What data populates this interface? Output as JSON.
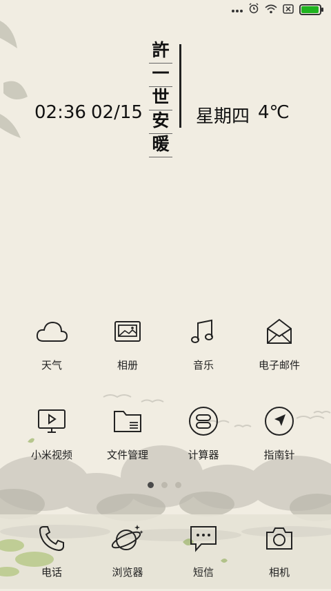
{
  "status_bar": {
    "battery_level": 0.95,
    "battery_color": "#1fb31f",
    "icons": [
      "more-dots-icon",
      "alarm-icon",
      "wifi-icon",
      "no-sim-icon",
      "battery-icon"
    ]
  },
  "clock": {
    "time": "02:36",
    "date": "02/15",
    "weekday": "星期四",
    "temperature": "4℃"
  },
  "calligraphy": {
    "characters": [
      "許",
      "一",
      "世",
      "安",
      "暖"
    ]
  },
  "apps": [
    {
      "label": "天气",
      "icon": "cloud-icon"
    },
    {
      "label": "相册",
      "icon": "photo-album-icon"
    },
    {
      "label": "音乐",
      "icon": "music-note-icon"
    },
    {
      "label": "电子邮件",
      "icon": "envelope-icon"
    },
    {
      "label": "小米视频",
      "icon": "video-player-icon"
    },
    {
      "label": "文件管理",
      "icon": "folder-icon"
    },
    {
      "label": "计算器",
      "icon": "calculator-icon"
    },
    {
      "label": "指南针",
      "icon": "compass-icon"
    }
  ],
  "page_indicator": {
    "count": 3,
    "active": 1
  },
  "dock": [
    {
      "label": "电话",
      "icon": "phone-icon"
    },
    {
      "label": "浏览器",
      "icon": "browser-planet-icon"
    },
    {
      "label": "短信",
      "icon": "message-bubble-icon"
    },
    {
      "label": "相机",
      "icon": "camera-icon"
    }
  ]
}
